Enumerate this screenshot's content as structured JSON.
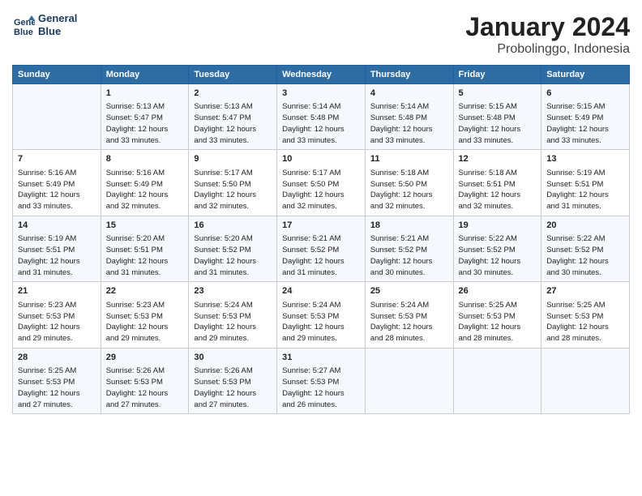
{
  "header": {
    "logo_line1": "General",
    "logo_line2": "Blue",
    "title": "January 2024",
    "subtitle": "Probolinggo, Indonesia"
  },
  "days_of_week": [
    "Sunday",
    "Monday",
    "Tuesday",
    "Wednesday",
    "Thursday",
    "Friday",
    "Saturday"
  ],
  "weeks": [
    [
      {
        "day": "",
        "info": ""
      },
      {
        "day": "1",
        "info": "Sunrise: 5:13 AM\nSunset: 5:47 PM\nDaylight: 12 hours\nand 33 minutes."
      },
      {
        "day": "2",
        "info": "Sunrise: 5:13 AM\nSunset: 5:47 PM\nDaylight: 12 hours\nand 33 minutes."
      },
      {
        "day": "3",
        "info": "Sunrise: 5:14 AM\nSunset: 5:48 PM\nDaylight: 12 hours\nand 33 minutes."
      },
      {
        "day": "4",
        "info": "Sunrise: 5:14 AM\nSunset: 5:48 PM\nDaylight: 12 hours\nand 33 minutes."
      },
      {
        "day": "5",
        "info": "Sunrise: 5:15 AM\nSunset: 5:48 PM\nDaylight: 12 hours\nand 33 minutes."
      },
      {
        "day": "6",
        "info": "Sunrise: 5:15 AM\nSunset: 5:49 PM\nDaylight: 12 hours\nand 33 minutes."
      }
    ],
    [
      {
        "day": "7",
        "info": "Sunrise: 5:16 AM\nSunset: 5:49 PM\nDaylight: 12 hours\nand 33 minutes."
      },
      {
        "day": "8",
        "info": "Sunrise: 5:16 AM\nSunset: 5:49 PM\nDaylight: 12 hours\nand 32 minutes."
      },
      {
        "day": "9",
        "info": "Sunrise: 5:17 AM\nSunset: 5:50 PM\nDaylight: 12 hours\nand 32 minutes."
      },
      {
        "day": "10",
        "info": "Sunrise: 5:17 AM\nSunset: 5:50 PM\nDaylight: 12 hours\nand 32 minutes."
      },
      {
        "day": "11",
        "info": "Sunrise: 5:18 AM\nSunset: 5:50 PM\nDaylight: 12 hours\nand 32 minutes."
      },
      {
        "day": "12",
        "info": "Sunrise: 5:18 AM\nSunset: 5:51 PM\nDaylight: 12 hours\nand 32 minutes."
      },
      {
        "day": "13",
        "info": "Sunrise: 5:19 AM\nSunset: 5:51 PM\nDaylight: 12 hours\nand 31 minutes."
      }
    ],
    [
      {
        "day": "14",
        "info": "Sunrise: 5:19 AM\nSunset: 5:51 PM\nDaylight: 12 hours\nand 31 minutes."
      },
      {
        "day": "15",
        "info": "Sunrise: 5:20 AM\nSunset: 5:51 PM\nDaylight: 12 hours\nand 31 minutes."
      },
      {
        "day": "16",
        "info": "Sunrise: 5:20 AM\nSunset: 5:52 PM\nDaylight: 12 hours\nand 31 minutes."
      },
      {
        "day": "17",
        "info": "Sunrise: 5:21 AM\nSunset: 5:52 PM\nDaylight: 12 hours\nand 31 minutes."
      },
      {
        "day": "18",
        "info": "Sunrise: 5:21 AM\nSunset: 5:52 PM\nDaylight: 12 hours\nand 30 minutes."
      },
      {
        "day": "19",
        "info": "Sunrise: 5:22 AM\nSunset: 5:52 PM\nDaylight: 12 hours\nand 30 minutes."
      },
      {
        "day": "20",
        "info": "Sunrise: 5:22 AM\nSunset: 5:52 PM\nDaylight: 12 hours\nand 30 minutes."
      }
    ],
    [
      {
        "day": "21",
        "info": "Sunrise: 5:23 AM\nSunset: 5:53 PM\nDaylight: 12 hours\nand 29 minutes."
      },
      {
        "day": "22",
        "info": "Sunrise: 5:23 AM\nSunset: 5:53 PM\nDaylight: 12 hours\nand 29 minutes."
      },
      {
        "day": "23",
        "info": "Sunrise: 5:24 AM\nSunset: 5:53 PM\nDaylight: 12 hours\nand 29 minutes."
      },
      {
        "day": "24",
        "info": "Sunrise: 5:24 AM\nSunset: 5:53 PM\nDaylight: 12 hours\nand 29 minutes."
      },
      {
        "day": "25",
        "info": "Sunrise: 5:24 AM\nSunset: 5:53 PM\nDaylight: 12 hours\nand 28 minutes."
      },
      {
        "day": "26",
        "info": "Sunrise: 5:25 AM\nSunset: 5:53 PM\nDaylight: 12 hours\nand 28 minutes."
      },
      {
        "day": "27",
        "info": "Sunrise: 5:25 AM\nSunset: 5:53 PM\nDaylight: 12 hours\nand 28 minutes."
      }
    ],
    [
      {
        "day": "28",
        "info": "Sunrise: 5:25 AM\nSunset: 5:53 PM\nDaylight: 12 hours\nand 27 minutes."
      },
      {
        "day": "29",
        "info": "Sunrise: 5:26 AM\nSunset: 5:53 PM\nDaylight: 12 hours\nand 27 minutes."
      },
      {
        "day": "30",
        "info": "Sunrise: 5:26 AM\nSunset: 5:53 PM\nDaylight: 12 hours\nand 27 minutes."
      },
      {
        "day": "31",
        "info": "Sunrise: 5:27 AM\nSunset: 5:53 PM\nDaylight: 12 hours\nand 26 minutes."
      },
      {
        "day": "",
        "info": ""
      },
      {
        "day": "",
        "info": ""
      },
      {
        "day": "",
        "info": ""
      }
    ]
  ]
}
